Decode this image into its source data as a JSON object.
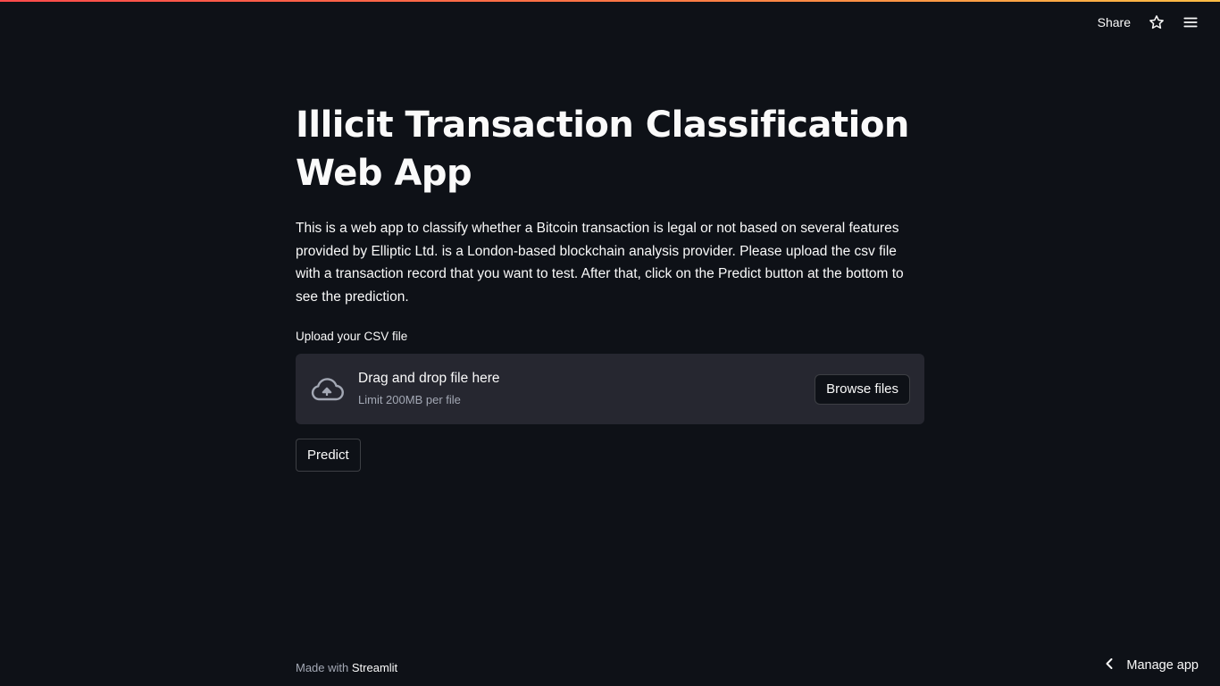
{
  "header": {
    "share_label": "Share",
    "star_icon": "star-icon",
    "menu_icon": "hamburger-menu-icon"
  },
  "main": {
    "title": "Illicit Transaction Classification Web App",
    "description": "This is a web app to classify whether a Bitcoin transaction is legal or not based on several features provided by Elliptic Ltd. is a London-based blockchain analysis provider. Please upload the csv file with a transaction record that you want to test. After that, click on the Predict button at the bottom to see the prediction.",
    "uploader": {
      "label": "Upload your CSV file",
      "drop_text": "Drag and drop file here",
      "limit_text": "Limit 200MB per file",
      "browse_label": "Browse files",
      "icon": "cloud-upload-icon"
    },
    "predict_label": "Predict"
  },
  "footer": {
    "prefix": "Made with ",
    "brand": "Streamlit"
  },
  "manage": {
    "label": "Manage app",
    "icon": "chevron-left-icon"
  },
  "colors": {
    "background": "#0e1117",
    "panel": "#262730",
    "text": "#fafafa",
    "muted": "#a3a8b4",
    "accent_start": "#ff4b4b",
    "accent_end": "#ffbd45"
  }
}
